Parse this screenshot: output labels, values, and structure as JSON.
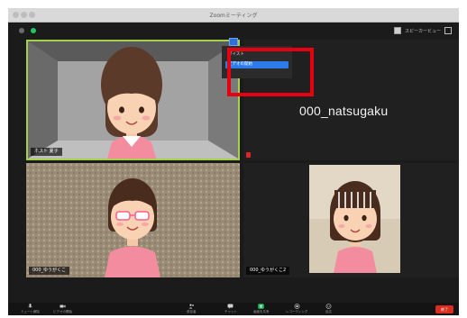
{
  "window": {
    "title": "Zoomミーティング"
  },
  "topbar": {
    "speaker_view_label": "スピーカービュー"
  },
  "participants": [
    {
      "name": "ホスト 夏子",
      "video": "avatar-girl-pink"
    },
    {
      "name": "000_natsugaku",
      "video": "off"
    },
    {
      "name": "000_ゆうがくこ",
      "video": "avatar-girl-glasses"
    },
    {
      "name": "000_ゆうがくこ2",
      "video": "avatar-girl-bangs"
    }
  ],
  "context_menu": {
    "items": [
      "ボイスト",
      "ビデオの開始"
    ],
    "selected_index": 1
  },
  "toolbar": {
    "items": [
      {
        "label": "ミュート解除",
        "icon": "mic-icon"
      },
      {
        "label": "ビデオの開始",
        "icon": "camera-icon"
      },
      {
        "label": "参加者",
        "icon": "participants-icon"
      },
      {
        "label": "チャット",
        "icon": "chat-icon"
      },
      {
        "label": "画面を共有",
        "icon": "share-screen-icon"
      },
      {
        "label": "レコーディング",
        "icon": "record-icon"
      },
      {
        "label": "反応",
        "icon": "reaction-icon"
      }
    ],
    "end_label": "終了"
  },
  "colors": {
    "active_speaker": "#a5d04a",
    "share_green": "#22c55e",
    "end_red": "#d92d20",
    "annotation_red": "#e60012"
  }
}
